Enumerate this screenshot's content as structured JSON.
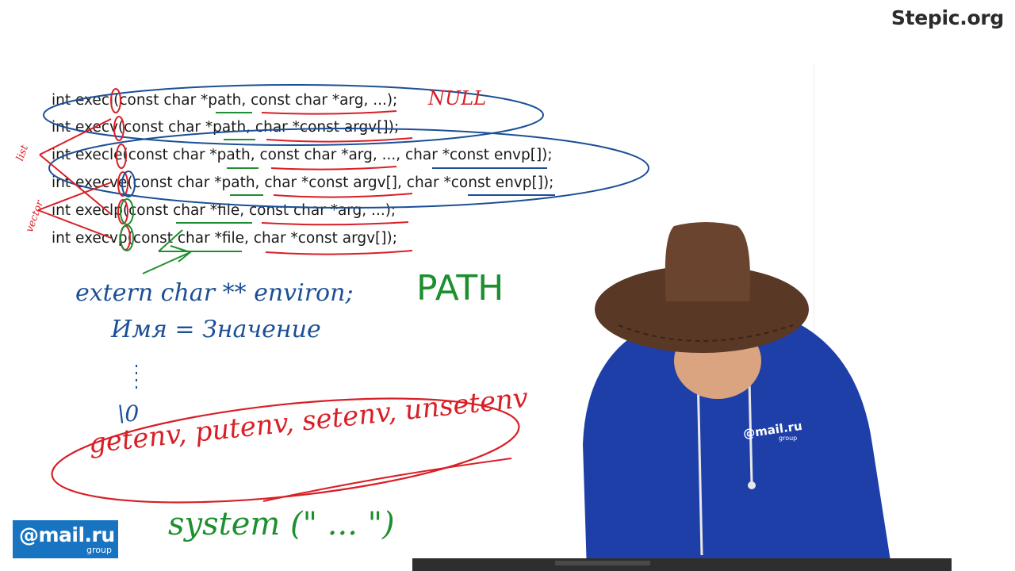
{
  "brand": "Stepic.org",
  "code_lines": [
    "int execl(const char *path, const char *arg, ...);",
    "int execv(const char *path, char *const argv[]);",
    "int execle(const char *path, const char *arg, ..., char *const envp[]);",
    "int execve(const char *path, char *const argv[], char *const envp[]);",
    "int execlp(const char *file, const char *arg, ...);",
    "int execvp(const char *file, char *const argv[]);"
  ],
  "annotations": {
    "null_note": "NULL",
    "side_list": "list",
    "side_vector": "vector",
    "path_var": "PATH",
    "environ_decl": "extern char ** environ;",
    "name_value": "Имя = Значение",
    "terminator": "\\0",
    "env_funcs": "getenv, putenv, setenv, unsetenv",
    "system_call": "system (\"  ...  \")"
  },
  "logo": {
    "main": "@mail.ru",
    "sub": "group"
  },
  "presenter": {
    "shirt_logo": "@mail.ru",
    "shirt_sub": "group"
  },
  "colors": {
    "blue_marker": "#1b4f96",
    "red_marker": "#d81f26",
    "green_marker": "#1e8f2e",
    "logo_bg": "#1874c1"
  }
}
